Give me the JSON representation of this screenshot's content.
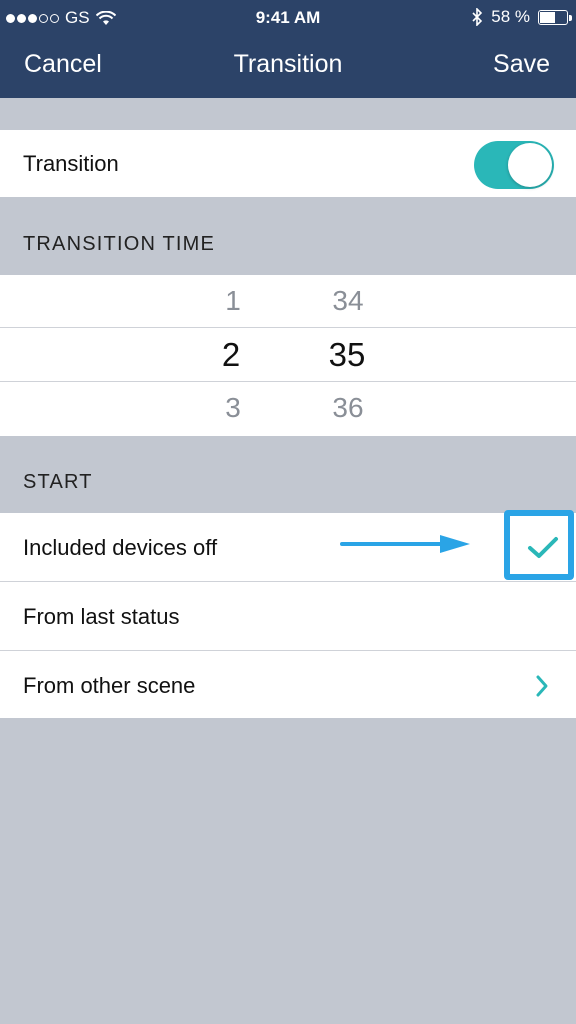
{
  "status_bar": {
    "carrier": "GS",
    "time": "9:41 AM",
    "battery": "58 %",
    "battery_level": 0.58
  },
  "nav": {
    "cancel_label": "Cancel",
    "title": "Transition",
    "save_label": "Save"
  },
  "transition_toggle": {
    "label": "Transition",
    "on": true
  },
  "transition_time": {
    "header": "TRANSITION TIME",
    "col1": {
      "above": "1",
      "selected": "2",
      "below": "3"
    },
    "col2": {
      "above": "34",
      "selected": "35",
      "below": "36"
    }
  },
  "start": {
    "header": "START",
    "options": [
      {
        "label": "Included devices off",
        "checked": true
      },
      {
        "label": "From last status"
      },
      {
        "label": "From other scene",
        "chevron": true
      }
    ]
  },
  "colors": {
    "nav_bg": "#2c4368",
    "accent": "#2ab7b8",
    "annotation": "#2aa4e6",
    "background": "#c2c7d0"
  }
}
